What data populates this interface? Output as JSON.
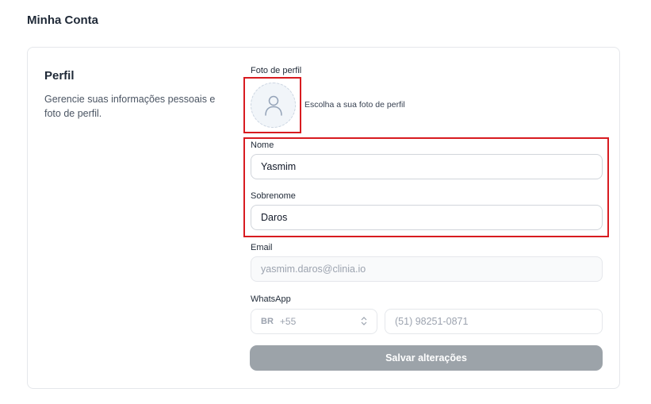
{
  "page": {
    "title": "Minha Conta"
  },
  "profile": {
    "title": "Perfil",
    "description": "Gerencie suas informações pessoais e foto de perfil."
  },
  "photo": {
    "label": "Foto de perfil",
    "hint": "Escolha a sua foto de perfil",
    "icon": "user-icon"
  },
  "first_name": {
    "label": "Nome",
    "value": "Yasmim"
  },
  "last_name": {
    "label": "Sobrenome",
    "value": "Daros"
  },
  "email": {
    "label": "Email",
    "value": "yasmim.daros@clinia.io"
  },
  "whatsapp": {
    "label": "WhatsApp",
    "country_prefix": "BR",
    "country_code": "+55",
    "placeholder": "(51) 98251-0871"
  },
  "save_button": {
    "label": "Salvar alterações"
  },
  "colors": {
    "highlight": "#d81b20",
    "button_disabled": "#9ca3a9"
  }
}
